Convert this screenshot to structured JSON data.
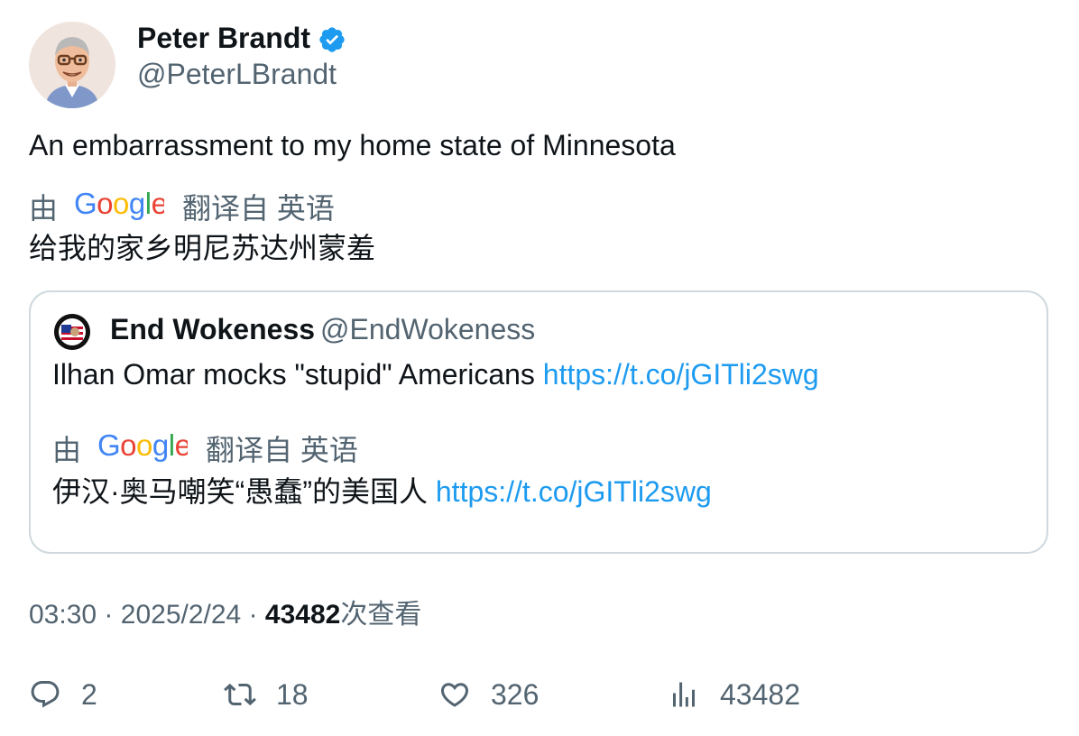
{
  "author": {
    "name": "Peter Brandt",
    "handle": "@PeterLBrandt",
    "verified": true,
    "avatar": "cartoon-man-glasses-avatar"
  },
  "tweet": {
    "text": "An embarrassment to my home state of Minnesota",
    "translation": {
      "by_label": "由",
      "brand": "Google",
      "from_label": "翻译自 英语",
      "text": "给我的家乡明尼苏达州蒙羞"
    }
  },
  "quote": {
    "name": "End Wokeness",
    "handle": "@EndWokeness",
    "avatar": "end-wokeness-flag-badge-avatar",
    "text": "Ilhan Omar mocks \"stupid\" Americans",
    "link": "https://t.co/jGITli2swg",
    "translation": {
      "by_label": "由",
      "brand": "Google",
      "from_label": "翻译自 英语",
      "text": "伊汉·奥马嘲笑“愚蠢”的美国人",
      "link": "https://t.co/jGITli2swg"
    }
  },
  "meta": {
    "time": "03:30",
    "separator": "·",
    "date": "2025/2/24",
    "views": "43482",
    "views_suffix": "次查看"
  },
  "actions": {
    "replies": "2",
    "retweets": "18",
    "likes": "326",
    "views": "43482"
  },
  "colors": {
    "link": "#1d9bf0",
    "secondary_text": "#536471",
    "border": "#cfd9de",
    "verified": "#1d9bf0"
  }
}
